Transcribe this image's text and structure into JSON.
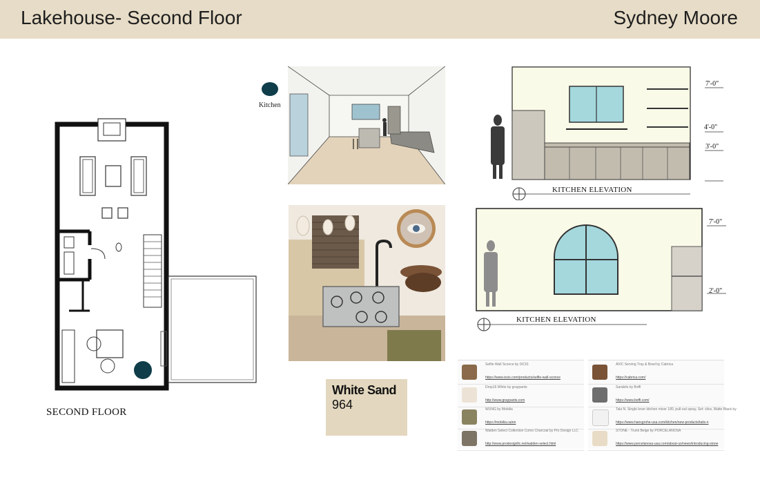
{
  "header": {
    "title": "Lakehouse- Second Floor",
    "author": "Sydney Moore"
  },
  "floor_plan": {
    "caption": "SECOND FLOOR"
  },
  "legend": {
    "label": "Kitchen",
    "color": "#0f3d4a"
  },
  "elevation_top": {
    "caption": "KITCHEN ELEVATION",
    "dims": [
      "7'-0\"",
      "4'-0\"",
      "3'-0\""
    ]
  },
  "elevation_bottom": {
    "caption": "KITCHEN ELEVATION",
    "dims": [
      "7'-0\"",
      "2'-0\""
    ]
  },
  "paint_swatch": {
    "name": "White Sand",
    "number": "964",
    "color": "#e3d7bf"
  },
  "product_list": {
    "left": [
      {
        "title": "Selfie Wall Sconce by IXCIS",
        "link": "https://www.ixcis.com/products/selfie-wall-sconce",
        "thumb": "mirror-icon"
      },
      {
        "title": "Drop16 White by graypants",
        "link": "http://www.graypants.com",
        "thumb": "pendant-icon"
      },
      {
        "title": "WUNG by Mobilia",
        "link": "https://mobilia.ca/en",
        "thumb": "rug-icon"
      },
      {
        "title": "Walden Select Collection Como Charcoal by Pro Design LLC",
        "link": "http://www.prodesignllc.net/walden-select.html",
        "thumb": "tile-icon"
      }
    ],
    "right": [
      {
        "title": "AVIC Serving Tray & Bowl by Cabrica",
        "link": "https://cabrica.com/",
        "thumb": "bowl-icon"
      },
      {
        "title": "Sarabilo by Boffi",
        "link": "https://www.boffi.com/",
        "thumb": "cooktop-icon"
      },
      {
        "title": "Tala N. Single lever kitchen mixer 180, pull-out spray, Set: slice, Matte Black by",
        "link": "https://www.hansgrohe-usa.com/kitchen/new-products/talis-n",
        "thumb": "faucet-icon"
      },
      {
        "title": "STONE - Trunk Beige by PORCELANOSA",
        "link": "https://www.porcelanosa-usa.com/about-us/news/introducing-stone",
        "thumb": "stone-icon"
      }
    ]
  }
}
